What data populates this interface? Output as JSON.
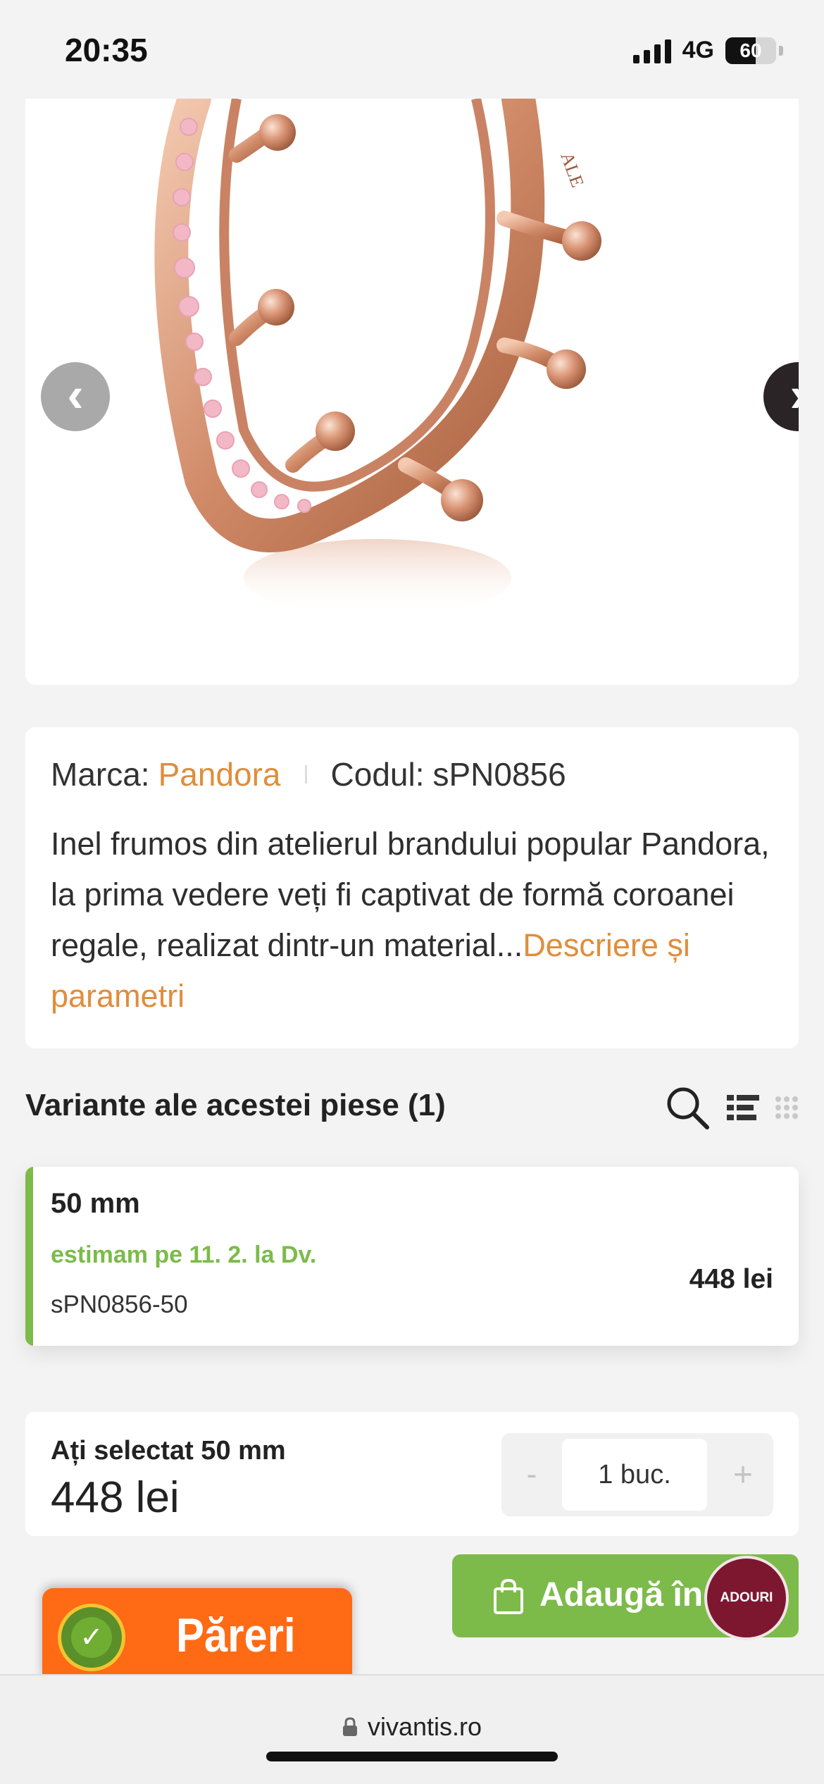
{
  "status_bar": {
    "time": "20:35",
    "network": "4G",
    "battery": "60",
    "battery_level": 0.6
  },
  "gallery": {
    "prev_icon": "‹",
    "next_icon": "›"
  },
  "product": {
    "brand_label": "Marca:",
    "brand": "Pandora",
    "code_label": "Codul:",
    "code": "sPN0856",
    "description": "Inel frumos din atelierul brandului popular Pandora, la prima vedere veți fi captivat de formă coroanei regale, realizat dintr-un material...",
    "more_link": "Descriere și parametri"
  },
  "variants": {
    "title": "Variante ale acestei piese (1)",
    "items": [
      {
        "size": "50 mm",
        "eta": "estimam pe 11. 2. la Dv.",
        "code": "sPN0856-50",
        "price": "448 lei"
      }
    ]
  },
  "selection": {
    "label": "Ați selectat 50 mm",
    "price": "448 lei",
    "minus": "-",
    "quantity": "1 buc.",
    "plus": "+"
  },
  "cart": {
    "add_label": "Adaugă în",
    "promo_text": "ADOURI"
  },
  "reviews": {
    "label": "Păreri"
  },
  "browser": {
    "url": "vivantis.ro"
  },
  "colors": {
    "accent_orange": "#e08d3c",
    "accent_green": "#7cbb4a",
    "reviews_orange": "#ff6a15"
  }
}
